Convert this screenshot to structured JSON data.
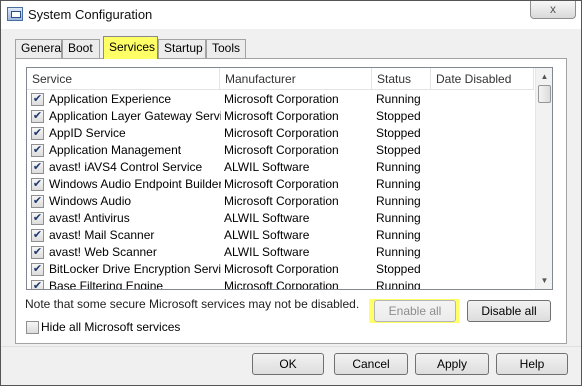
{
  "window": {
    "title": "System Configuration",
    "close_glyph": "x",
    "app_icon": "msconfig-icon"
  },
  "tabs": [
    {
      "label": "General",
      "active": false
    },
    {
      "label": "Boot",
      "active": false
    },
    {
      "label": "Services",
      "active": true
    },
    {
      "label": "Startup",
      "active": false
    },
    {
      "label": "Tools",
      "active": false
    }
  ],
  "list": {
    "columns": [
      "Service",
      "Manufacturer",
      "Status",
      "Date Disabled"
    ],
    "rows": [
      {
        "service": "Application Experience",
        "manufacturer": "Microsoft Corporation",
        "status": "Running",
        "date_disabled": "",
        "checked": true
      },
      {
        "service": "Application Layer Gateway Service",
        "manufacturer": "Microsoft Corporation",
        "status": "Stopped",
        "date_disabled": "",
        "checked": true
      },
      {
        "service": "AppID Service",
        "manufacturer": "Microsoft Corporation",
        "status": "Stopped",
        "date_disabled": "",
        "checked": true
      },
      {
        "service": "Application Management",
        "manufacturer": "Microsoft Corporation",
        "status": "Stopped",
        "date_disabled": "",
        "checked": true
      },
      {
        "service": "avast! iAVS4 Control Service",
        "manufacturer": "ALWIL Software",
        "status": "Running",
        "date_disabled": "",
        "checked": true
      },
      {
        "service": "Windows Audio Endpoint Builder",
        "manufacturer": "Microsoft Corporation",
        "status": "Running",
        "date_disabled": "",
        "checked": true
      },
      {
        "service": "Windows Audio",
        "manufacturer": "Microsoft Corporation",
        "status": "Running",
        "date_disabled": "",
        "checked": true
      },
      {
        "service": "avast! Antivirus",
        "manufacturer": "ALWIL Software",
        "status": "Running",
        "date_disabled": "",
        "checked": true
      },
      {
        "service": "avast! Mail Scanner",
        "manufacturer": "ALWIL Software",
        "status": "Running",
        "date_disabled": "",
        "checked": true
      },
      {
        "service": "avast! Web Scanner",
        "manufacturer": "ALWIL Software",
        "status": "Running",
        "date_disabled": "",
        "checked": true
      },
      {
        "service": "BitLocker Drive Encryption Service",
        "manufacturer": "Microsoft Corporation",
        "status": "Stopped",
        "date_disabled": "",
        "checked": true
      },
      {
        "service": "Base Filtering Engine",
        "manufacturer": "Microsoft Corporation",
        "status": "Running",
        "date_disabled": "",
        "checked": true
      }
    ]
  },
  "note": "Note that some secure Microsoft services may not be disabled.",
  "buttons": {
    "enable_all": "Enable all",
    "disable_all": "Disable all",
    "ok": "OK",
    "cancel": "Cancel",
    "apply": "Apply",
    "help": "Help"
  },
  "hide_ms": {
    "label": "Hide all Microsoft services",
    "checked": false
  },
  "colors": {
    "highlight": "#ffff66",
    "window_bg": "#f0f0f0"
  },
  "icons": {
    "check": "✔",
    "scroll_up": "▲",
    "scroll_down": "▼"
  }
}
